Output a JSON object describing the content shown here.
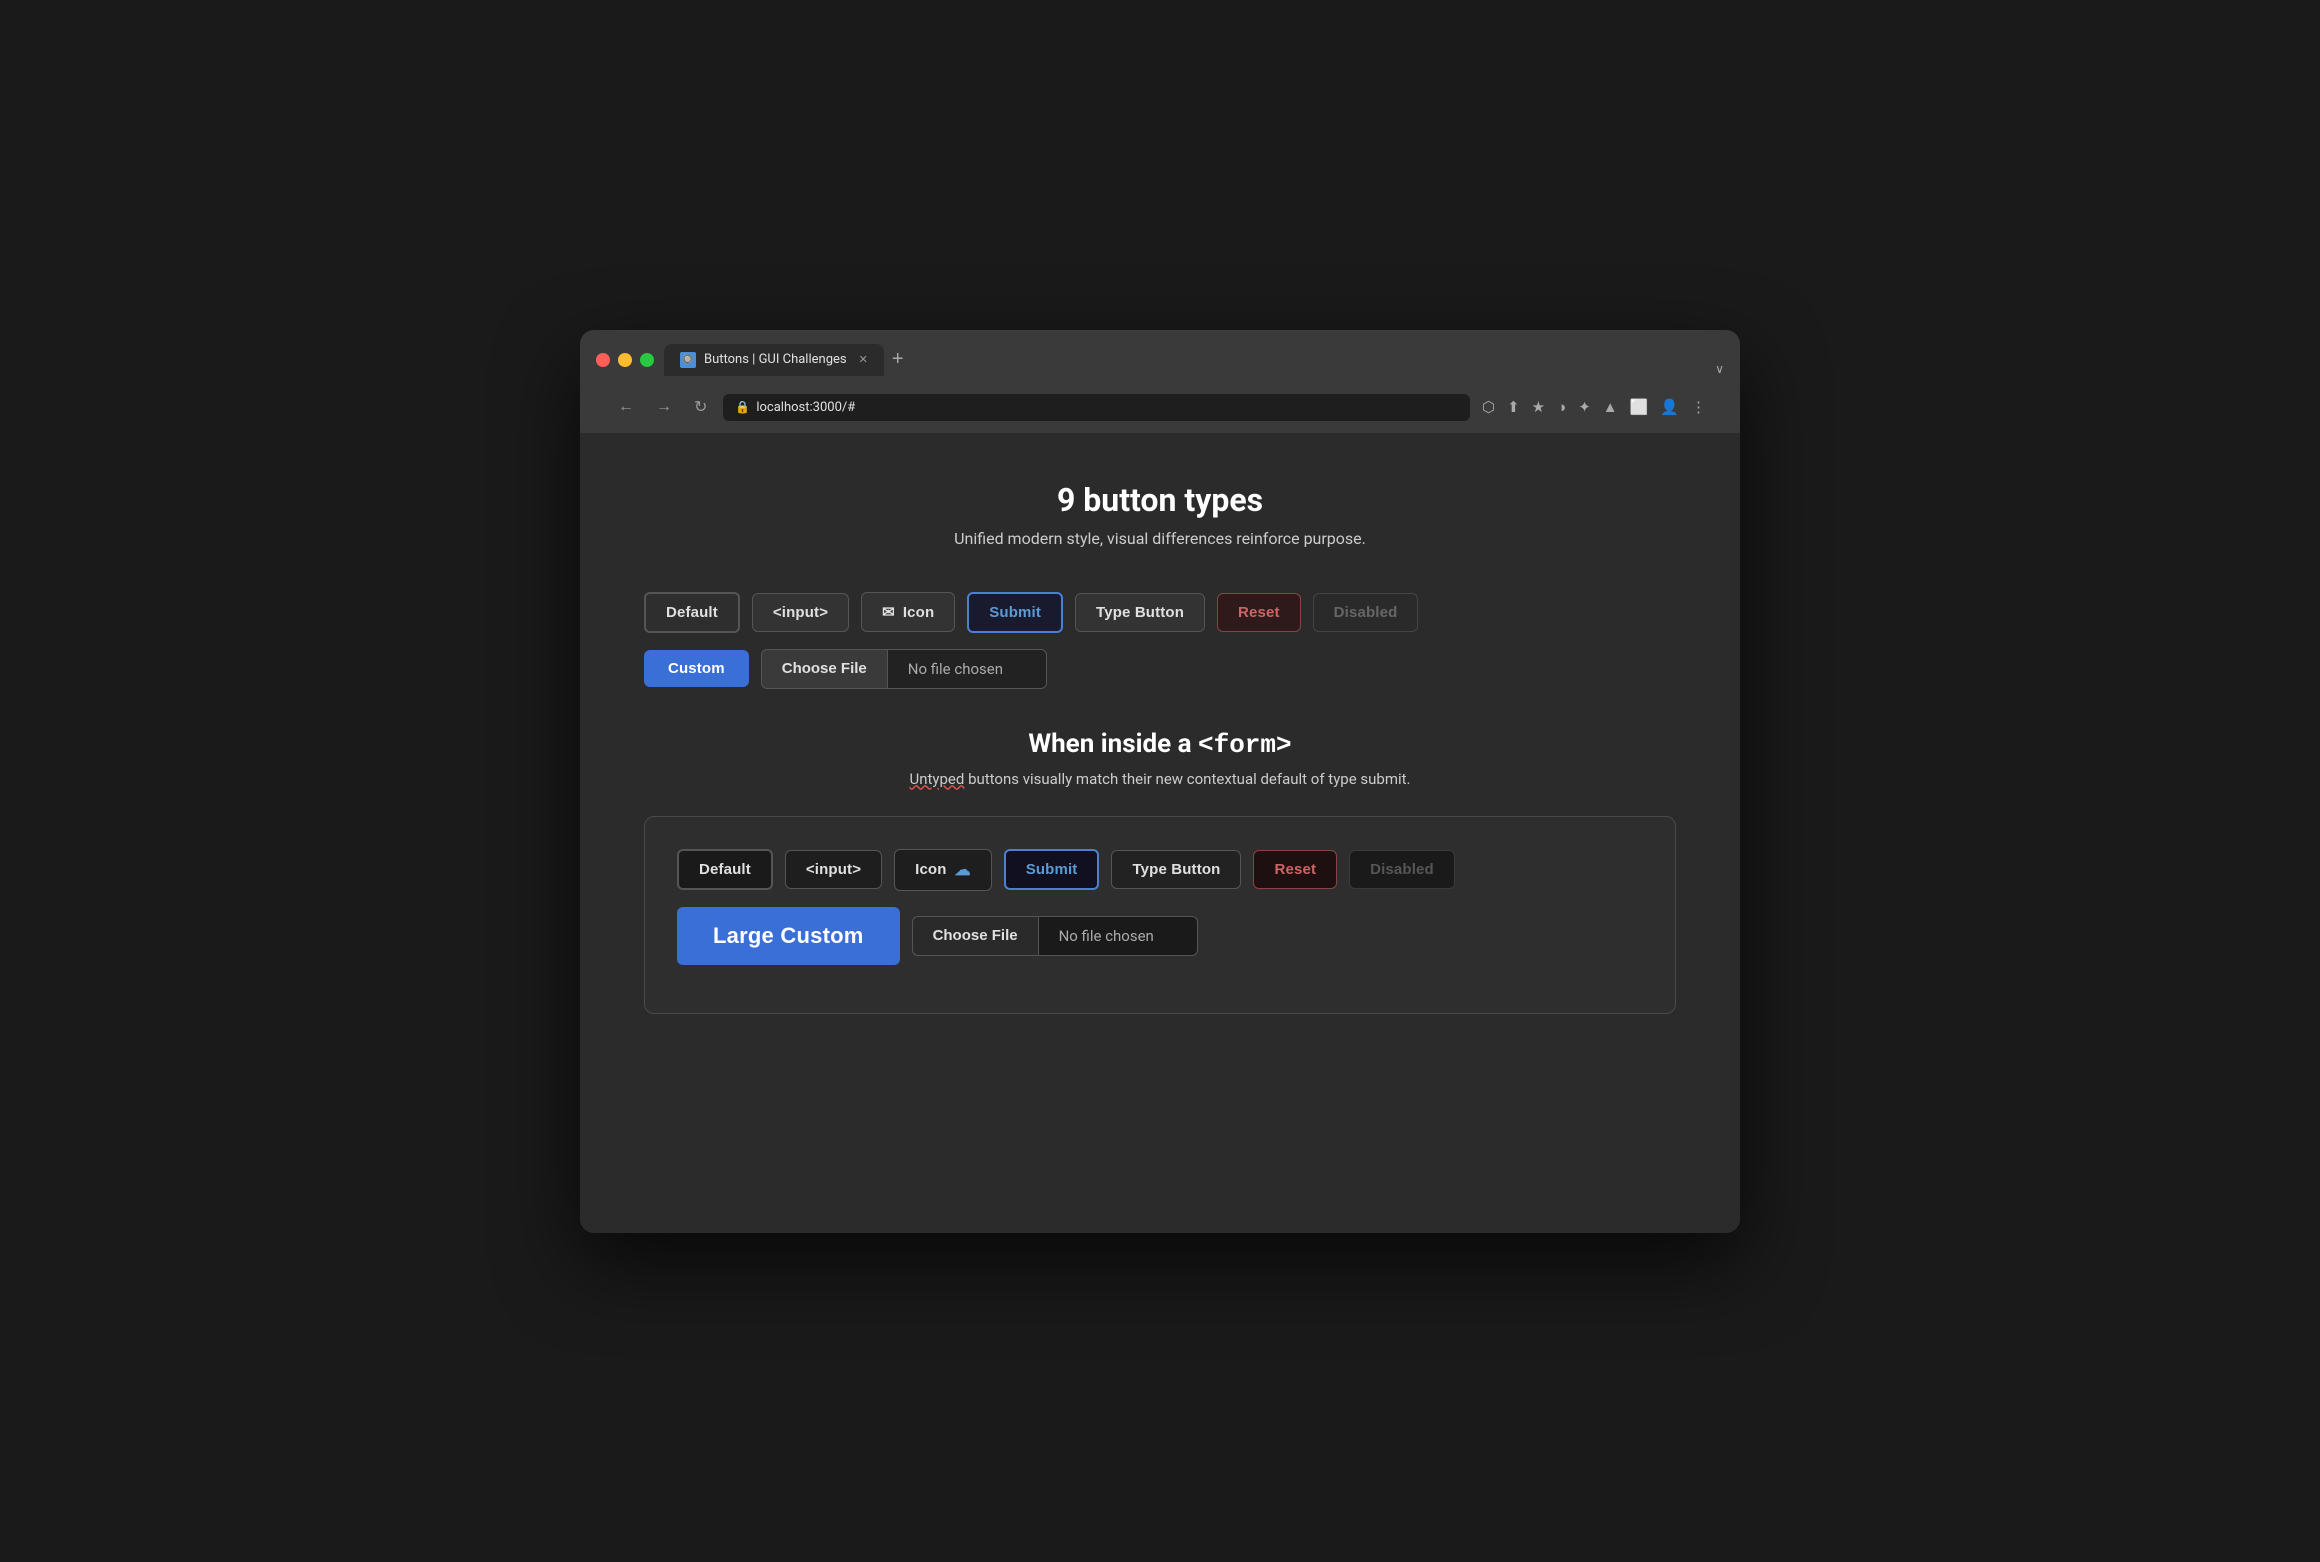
{
  "browser": {
    "tab_title": "Buttons | GUI Challenges",
    "tab_favicon": "🔘",
    "url": "localhost:3000/#",
    "new_tab_label": "+",
    "chevron": "∨"
  },
  "nav": {
    "back": "←",
    "forward": "→",
    "refresh": "↻",
    "more": "⋮"
  },
  "toolbar": {
    "icons": [
      "⬡",
      "⬆",
      "★",
      "◑",
      "✦",
      "▲",
      "⬜",
      "👤",
      "⋮"
    ]
  },
  "page": {
    "title": "9 button types",
    "subtitle": "Unified modern style, visual differences reinforce purpose.",
    "buttons_row1": [
      {
        "label": "Default",
        "type": "default"
      },
      {
        "label": "<input>",
        "type": "input"
      },
      {
        "label": "Icon",
        "type": "icon",
        "has_icon": true
      },
      {
        "label": "Submit",
        "type": "submit"
      },
      {
        "label": "Type Button",
        "type": "type-button"
      },
      {
        "label": "Reset",
        "type": "reset"
      },
      {
        "label": "Disabled",
        "type": "disabled"
      }
    ],
    "custom_label": "Custom",
    "choose_file_label": "Choose File",
    "no_file_chosen_label": "No file chosen",
    "form_section": {
      "title_prefix": "When inside a ",
      "title_code": "<form>",
      "subtitle_normal": " buttons visually match their new contextual default of type submit.",
      "subtitle_untyped": "Untyped",
      "form_buttons_row": [
        {
          "label": "Default",
          "type": "form-default"
        },
        {
          "label": "<input>",
          "type": "form-input"
        },
        {
          "label": "Icon",
          "type": "form-icon",
          "has_cloud": true
        },
        {
          "label": "Submit",
          "type": "form-submit"
        },
        {
          "label": "Type Button",
          "type": "form-type-button"
        },
        {
          "label": "Reset",
          "type": "form-reset"
        },
        {
          "label": "Disabled",
          "type": "form-disabled"
        }
      ],
      "large_custom_label": "Large Custom",
      "choose_file_label": "Choose File",
      "no_file_chosen_label": "No file chosen"
    }
  }
}
